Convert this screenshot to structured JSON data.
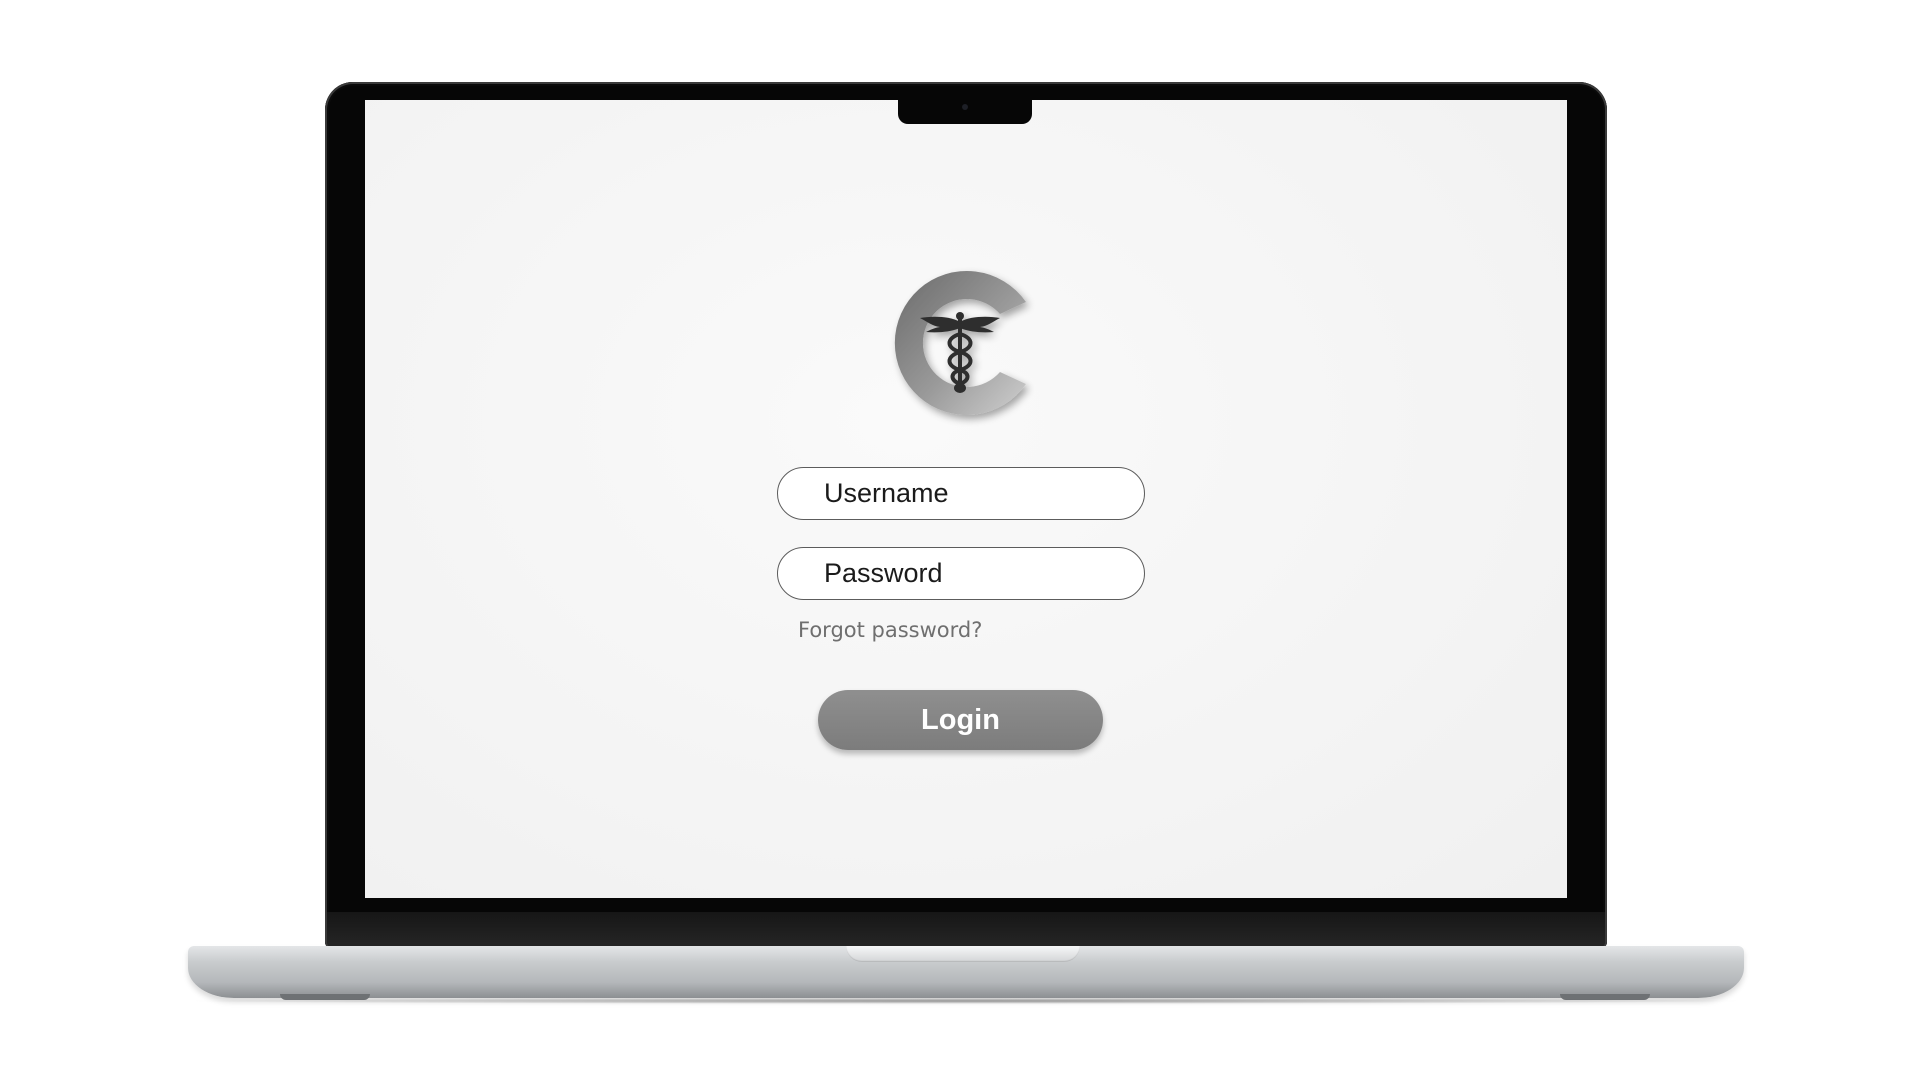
{
  "login": {
    "username_placeholder": "Username",
    "password_placeholder": "Password",
    "forgot_password_label": "Forgot password?",
    "login_label": "Login"
  },
  "logo": {
    "icon": "caduceus-c-logo-icon"
  },
  "colors": {
    "login_button": "#8a8a8a",
    "screen_background": "#f6f6f6",
    "field_border": "#5c5c5c",
    "link_text": "#6f6f6f"
  }
}
